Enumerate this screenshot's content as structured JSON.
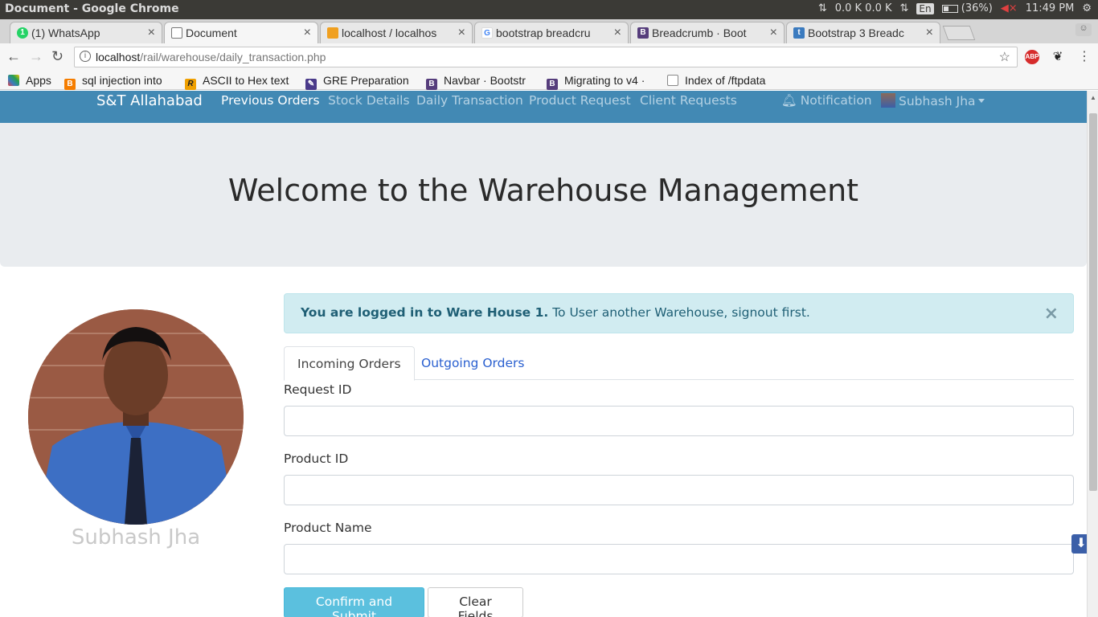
{
  "os": {
    "window_title": "Document - Google Chrome",
    "net_stats": "0.0 K 0.0 K",
    "lang": "En",
    "battery": "(36%)",
    "time": "11:49 PM"
  },
  "tabs": [
    {
      "label": "(1) WhatsApp",
      "icon": "whatsapp-icon",
      "color": "#25d366"
    },
    {
      "label": "Document",
      "icon": "document-icon",
      "color": "#777777"
    },
    {
      "label": "localhost / localhos",
      "icon": "phpmyadmin-icon",
      "color": "#f0a020"
    },
    {
      "label": "bootstrap breadcru",
      "icon": "google-icon",
      "color": "#4285f4"
    },
    {
      "label": "Breadcrumb · Boot",
      "icon": "bootstrap-icon",
      "color": "#563d7c"
    },
    {
      "label": "Bootstrap 3 Breadc",
      "icon": "tutorial-icon",
      "color": "#3b7bbf"
    }
  ],
  "address": {
    "host": "localhost",
    "path": "/rail/warehouse/daily_transaction.php"
  },
  "bookmarks": [
    {
      "label": "Apps",
      "icon": "apps-grid-icon",
      "color": "#e04040"
    },
    {
      "label": "sql injection into",
      "icon": "blogger-icon",
      "color": "#f57d00"
    },
    {
      "label": "ASCII to Hex text",
      "icon": "r-icon",
      "color": "#f0a000"
    },
    {
      "label": "GRE Preparation",
      "icon": "feather-icon",
      "color": "#4a3a8a"
    },
    {
      "label": "Navbar · Bootstr",
      "icon": "bootstrap-icon",
      "color": "#563d7c"
    },
    {
      "label": "Migrating to v4 ·",
      "icon": "bootstrap-icon",
      "color": "#563d7c"
    },
    {
      "label": "Index of /ftpdata",
      "icon": "page-icon",
      "color": "#888888"
    }
  ],
  "navbar": {
    "brand": "S&T Allahabad",
    "links": [
      "Previous Orders",
      "Stock Details",
      "Daily Transaction",
      "Product Request",
      "Client Requests"
    ],
    "notification": "Notification",
    "user": "Subhash Jha"
  },
  "jumbotron": {
    "heading": "Welcome to the Warehouse Management"
  },
  "profile": {
    "name": "Subhash Jha"
  },
  "alert": {
    "strong": "You are logged in to Ware House 1.",
    "text": " To User another Warehouse, signout first.",
    "close": "×"
  },
  "form_tabs": [
    "Incoming Orders",
    "Outgoing Orders"
  ],
  "form": {
    "request_id_label": "Request ID",
    "product_id_label": "Product ID",
    "product_name_label": "Product Name",
    "request_id_value": "",
    "product_id_value": "",
    "product_name_value": "",
    "submit_label": "Confirm and Submit",
    "clear_label": "Clear Fields"
  },
  "colors": {
    "navbar": "#4289b4",
    "jumbotron": "#e9ecef",
    "alert_bg": "#d1ecf1",
    "primary_btn": "#5bc0de"
  }
}
